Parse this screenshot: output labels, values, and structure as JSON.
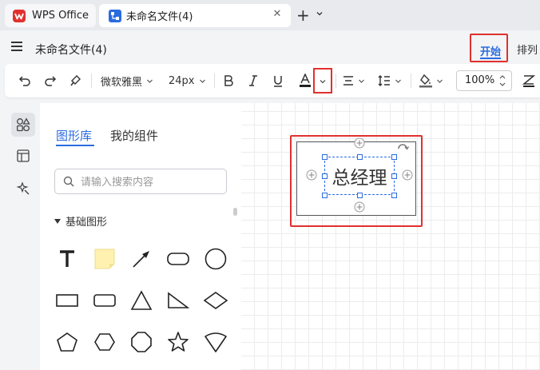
{
  "tabs": {
    "app": {
      "label": "WPS Office"
    },
    "document": {
      "label": "未命名文件(4)"
    }
  },
  "header": {
    "doc_title": "未命名文件(4)",
    "menu_tabs": {
      "start": "开始",
      "arrange": "排列"
    }
  },
  "toolbar": {
    "font_family": "微软雅黑",
    "font_size": "24px",
    "zoom": "100%"
  },
  "panel": {
    "tabs": {
      "library": "图形库",
      "mine": "我的组件"
    },
    "search": {
      "placeholder": "请输入搜索内容"
    },
    "section_title": "基础图形"
  },
  "canvas": {
    "shape_text": "总经理"
  },
  "colors": {
    "accent": "#2a6be0",
    "highlight": "#e0312e"
  }
}
